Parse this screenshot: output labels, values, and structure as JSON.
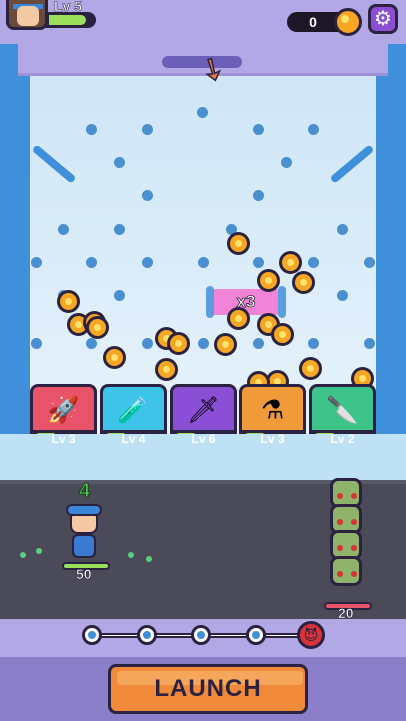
{
  "player": {
    "level_label": "Lv 5",
    "xp_fraction": 0.85
  },
  "currency": {
    "coins": "0"
  },
  "board": {
    "multiplier_label": "x3"
  },
  "weapons": [
    {
      "name": "rocket",
      "level": "Lv 3",
      "color": "#e8546a",
      "icon": "rocket-icon"
    },
    {
      "name": "potion",
      "level": "Lv 4",
      "color": "#3ec4e8",
      "icon": "potion-icon"
    },
    {
      "name": "dagger",
      "level": "Lv 6",
      "color": "#8b4fd6",
      "icon": "dagger-icon"
    },
    {
      "name": "poison",
      "level": "Lv 3",
      "color": "#f09a3a",
      "icon": "poison-flask-icon"
    },
    {
      "name": "knife",
      "level": "Lv 2",
      "color": "#3ec48a",
      "icon": "knife-icon"
    }
  ],
  "battle": {
    "damage_popup": "4",
    "hero_hp": "50",
    "enemy_hp": "20"
  },
  "launch_label": "LAUNCH"
}
